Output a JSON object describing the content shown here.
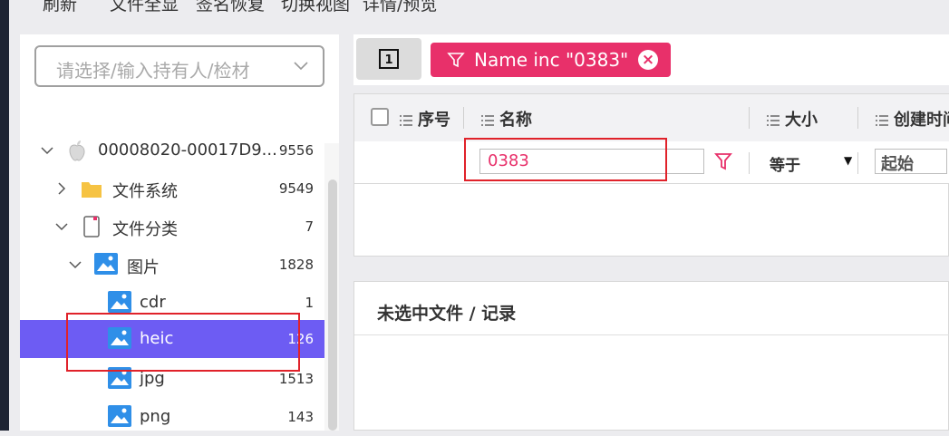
{
  "menu": [
    "刷新",
    "文件全显",
    "签名恢复",
    "切换视图",
    "详情/预览"
  ],
  "owner_select": {
    "placeholder": "请选择/输入持有人/检材"
  },
  "tree": [
    {
      "label": "00008020-00017D9...",
      "count": "9556",
      "icon": "apple-icon",
      "expanded": true
    },
    {
      "label": "文件系统",
      "count": "9549",
      "icon": "folder-icon",
      "expanded": false
    },
    {
      "label": "文件分类",
      "count": "7",
      "icon": "document-icon",
      "expanded": true
    },
    {
      "label": "图片",
      "count": "1828",
      "icon": "image-icon",
      "expanded": true
    },
    {
      "label": "cdr",
      "count": "1",
      "icon": "image-icon"
    },
    {
      "label": "heic",
      "count": "126",
      "icon": "image-icon",
      "selected": true
    },
    {
      "label": "jpg",
      "count": "1513",
      "icon": "image-icon"
    },
    {
      "label": "png",
      "count": "143",
      "icon": "image-icon"
    }
  ],
  "toolbar": {
    "column_toggle_icon": "column-toggle-icon",
    "filter_chip": "Name inc \"0383\""
  },
  "grid": {
    "columns": [
      "序号",
      "名称",
      "大小",
      "创建时间"
    ],
    "filter": {
      "name_value": "0383",
      "size_operator": "等于",
      "date_start": "起始"
    }
  },
  "detail": {
    "title": "未选中文件 / 记录"
  },
  "colors": {
    "accent": "#e8306a",
    "selected": "#6d5cf3",
    "highlight_box": "#e0222a"
  }
}
